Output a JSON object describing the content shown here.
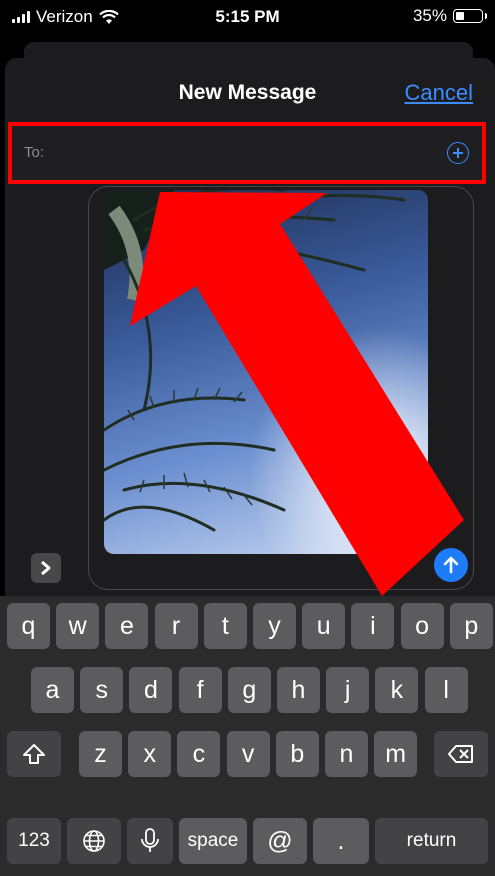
{
  "status_bar": {
    "carrier": "Verizon",
    "time": "5:15 PM",
    "battery_percent": "35%",
    "battery_level": 0.35,
    "icons": [
      "signal-icon",
      "wifi-icon",
      "battery-icon"
    ]
  },
  "header": {
    "title": "New Message",
    "cancel_label": "Cancel"
  },
  "recipient": {
    "label": "To:",
    "value": "",
    "add_icon": "add-contact-icon"
  },
  "compose": {
    "attachment": "palm-tree-photo",
    "expand_icon": "chevron-right-icon",
    "send_icon": "arrow-up-icon"
  },
  "colors": {
    "accent": "#3a8cff",
    "send_button": "#1e7cf6",
    "annotation": "#ff0000"
  },
  "keyboard": {
    "row1": [
      "q",
      "w",
      "e",
      "r",
      "t",
      "y",
      "u",
      "i",
      "o",
      "p"
    ],
    "row2": [
      "a",
      "s",
      "d",
      "f",
      "g",
      "h",
      "j",
      "k",
      "l"
    ],
    "row3": [
      "z",
      "x",
      "c",
      "v",
      "b",
      "n",
      "m"
    ],
    "numbers_label": "123",
    "space_label": "space",
    "at_label": "@",
    "period_label": ".",
    "return_label": "return",
    "shift_icon": "shift-icon",
    "delete_icon": "delete-icon",
    "globe_icon": "globe-icon",
    "mic_icon": "microphone-icon"
  }
}
